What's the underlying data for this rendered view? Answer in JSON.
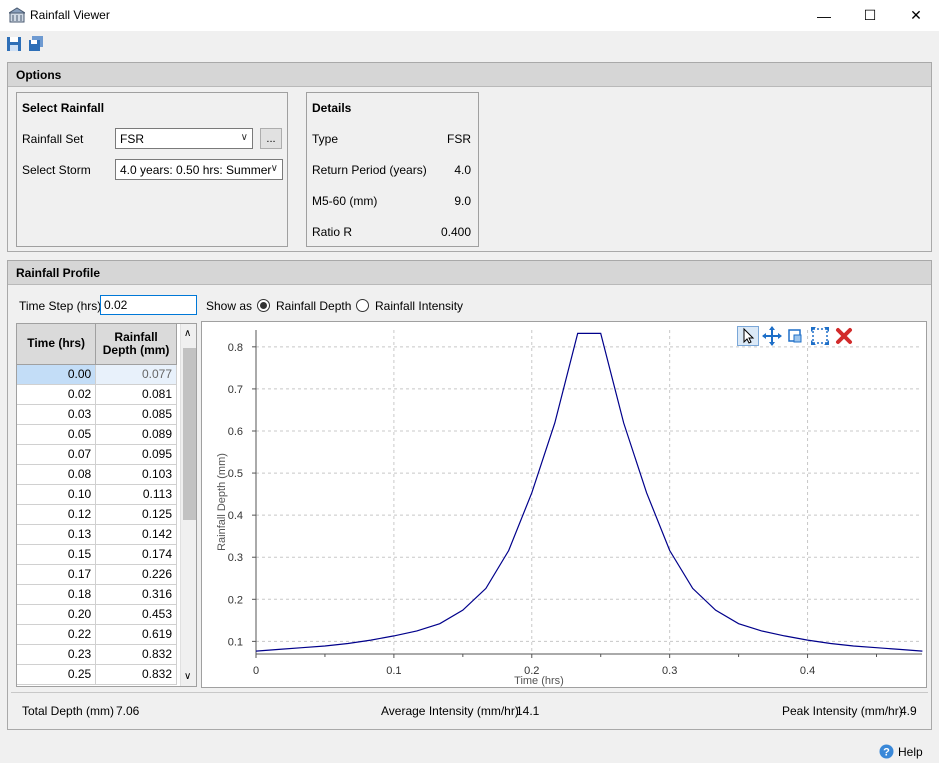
{
  "window": {
    "title": "Rainfall Viewer",
    "minimize": "—",
    "maximize": "☐",
    "close": "✕"
  },
  "options": {
    "header": "Options",
    "select_rainfall": {
      "title": "Select Rainfall",
      "rainfall_set_label": "Rainfall Set",
      "rainfall_set_value": "FSR",
      "ellipsis": "...",
      "select_storm_label": "Select Storm",
      "select_storm_value": "4.0 years: 0.50 hrs: Summer"
    },
    "details": {
      "title": "Details",
      "rows": [
        {
          "label": "Type",
          "value": "FSR"
        },
        {
          "label": "Return Period (years)",
          "value": "4.0"
        },
        {
          "label": "M5-60 (mm)",
          "value": "9.0"
        },
        {
          "label": "Ratio R",
          "value": "0.400"
        }
      ]
    }
  },
  "profile": {
    "header": "Rainfall Profile",
    "time_step_label": "Time Step (hrs)",
    "time_step_value": "0.02",
    "show_as_label": "Show as",
    "radio_depth": "Rainfall Depth",
    "radio_intensity": "Rainfall Intensity",
    "selected_mode": "Rainfall Depth",
    "table": {
      "headers": [
        "Time (hrs)",
        "Rainfall Depth (mm)"
      ],
      "rows": [
        [
          "0.00",
          "0.077"
        ],
        [
          "0.02",
          "0.081"
        ],
        [
          "0.03",
          "0.085"
        ],
        [
          "0.05",
          "0.089"
        ],
        [
          "0.07",
          "0.095"
        ],
        [
          "0.08",
          "0.103"
        ],
        [
          "0.10",
          "0.113"
        ],
        [
          "0.12",
          "0.125"
        ],
        [
          "0.13",
          "0.142"
        ],
        [
          "0.15",
          "0.174"
        ],
        [
          "0.17",
          "0.226"
        ],
        [
          "0.18",
          "0.316"
        ],
        [
          "0.20",
          "0.453"
        ],
        [
          "0.22",
          "0.619"
        ],
        [
          "0.23",
          "0.832"
        ],
        [
          "0.25",
          "0.832"
        ]
      ]
    },
    "footer": {
      "total_depth_label": "Total Depth (mm)",
      "total_depth_value": "7.06",
      "avg_intensity_label": "Average Intensity (mm/hr)",
      "avg_intensity_value": "14.1",
      "peak_intensity_label": "Peak Intensity (mm/hr)",
      "peak_intensity_value": "4.9"
    }
  },
  "help_label": "Help",
  "chart_data": {
    "type": "line",
    "title": "",
    "xlabel": "Time (hrs)",
    "ylabel": "Rainfall Depth (mm)",
    "xlim": [
      0,
      0.483
    ],
    "ylim": [
      0.07,
      0.84
    ],
    "xticks": [
      0,
      0.1,
      0.2,
      0.3,
      0.4
    ],
    "yticks": [
      0.1,
      0.2,
      0.3,
      0.4,
      0.5,
      0.6,
      0.7,
      0.8
    ],
    "grid": true,
    "line_color": "#00008b",
    "x": [
      0,
      0.0167,
      0.0333,
      0.05,
      0.0667,
      0.0833,
      0.1,
      0.1167,
      0.1333,
      0.15,
      0.1667,
      0.1833,
      0.2,
      0.2167,
      0.2333,
      0.25,
      0.2667,
      0.2833,
      0.3,
      0.3167,
      0.3333,
      0.35,
      0.3667,
      0.3833,
      0.4,
      0.4167,
      0.4333,
      0.45,
      0.4667,
      0.4833
    ],
    "y": [
      0.077,
      0.081,
      0.085,
      0.089,
      0.095,
      0.103,
      0.113,
      0.125,
      0.142,
      0.174,
      0.226,
      0.316,
      0.453,
      0.619,
      0.832,
      0.832,
      0.619,
      0.453,
      0.316,
      0.226,
      0.174,
      0.142,
      0.125,
      0.113,
      0.103,
      0.095,
      0.089,
      0.085,
      0.081,
      0.077
    ]
  }
}
